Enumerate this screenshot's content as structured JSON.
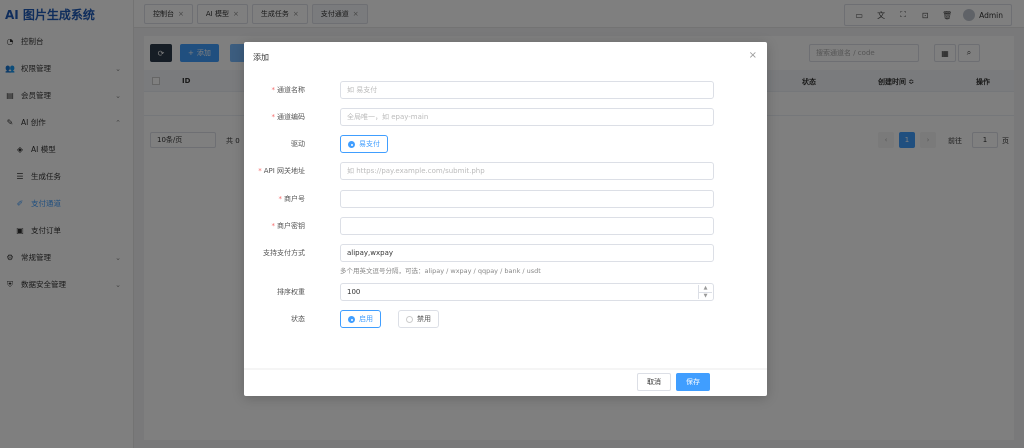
{
  "app": {
    "title": "AI 图片生成系统"
  },
  "sidebar": {
    "items": [
      {
        "label": "控制台",
        "icon": "dashboard-icon",
        "has_children": false
      },
      {
        "label": "权限管理",
        "icon": "users-icon",
        "has_children": true
      },
      {
        "label": "会员管理",
        "icon": "id-card-icon",
        "has_children": true
      },
      {
        "label": "AI 创作",
        "icon": "magic-wand-icon",
        "has_children": true,
        "expanded": true
      },
      {
        "label": "AI 模型",
        "icon": "cube-icon",
        "sub": true
      },
      {
        "label": "生成任务",
        "icon": "list-icon",
        "sub": true
      },
      {
        "label": "支付通道",
        "icon": "paint-brush-icon",
        "sub": true,
        "active": true
      },
      {
        "label": "支付订单",
        "icon": "money-icon",
        "sub": true
      },
      {
        "label": "常规管理",
        "icon": "cogs-icon",
        "has_children": true
      },
      {
        "label": "数据安全管理",
        "icon": "shield-icon",
        "has_children": true
      }
    ]
  },
  "tabs": [
    {
      "label": "控制台"
    },
    {
      "label": "AI 模型"
    },
    {
      "label": "生成任务"
    },
    {
      "label": "支付通道",
      "active": true
    }
  ],
  "header": {
    "user": "Admin"
  },
  "toolbar": {
    "add_label": "添加",
    "search_placeholder": "搜索通道名 / code"
  },
  "table": {
    "columns": [
      "ID",
      "状态",
      "创建时间 ≎",
      "操作"
    ]
  },
  "pagination": {
    "page_size": "10条/页",
    "total": "共 0",
    "current_page": "1",
    "goto_label": "前往",
    "goto_value": "1",
    "page_unit": "页"
  },
  "modal": {
    "title": "添加",
    "fields": {
      "name": {
        "label": "通道名称",
        "placeholder": "如 易支付"
      },
      "code": {
        "label": "通道编码",
        "placeholder": "全局唯一，如 epay-main"
      },
      "driver": {
        "label": "驱动",
        "option": "易支付"
      },
      "gateway": {
        "label": "API 网关地址",
        "placeholder": "如 https://pay.example.com/submit.php"
      },
      "merchant_id": {
        "label": "商户号",
        "value": ""
      },
      "merchant_key": {
        "label": "商户密钥",
        "value": ""
      },
      "methods": {
        "label": "支持支付方式",
        "value": "alipay,wxpay",
        "hint": "多个用英文逗号分隔，可选：alipay / wxpay / qqpay / bank / usdt"
      },
      "weight": {
        "label": "排序权重",
        "value": "100"
      },
      "status": {
        "label": "状态",
        "on": "启用",
        "off": "禁用"
      }
    },
    "cancel_label": "取消",
    "save_label": "保存"
  },
  "colors": {
    "primary": "#409eff",
    "brand": "#1e5bb8",
    "required": "#f56c6c"
  }
}
